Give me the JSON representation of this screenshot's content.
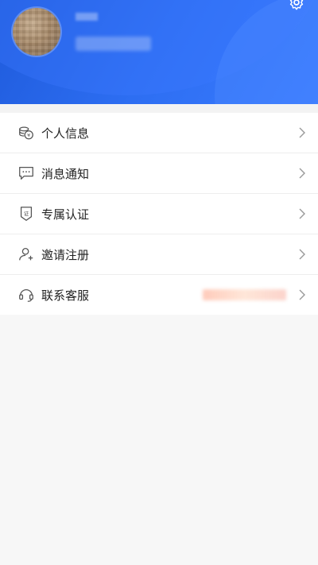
{
  "header": {
    "settings_icon": "gear-icon",
    "avatar_desc": "avatar"
  },
  "menu": {
    "items": [
      {
        "label": "个人信息",
        "icon": "coins-icon"
      },
      {
        "label": "消息通知",
        "icon": "message-icon"
      },
      {
        "label": "专属认证",
        "icon": "badge-icon"
      },
      {
        "label": "邀请注册",
        "icon": "user-add-icon"
      },
      {
        "label": "联系客服",
        "icon": "headset-icon"
      }
    ]
  },
  "colors": {
    "header_blue": "#2d6ef2",
    "text": "#222222",
    "divider": "#ededed"
  }
}
